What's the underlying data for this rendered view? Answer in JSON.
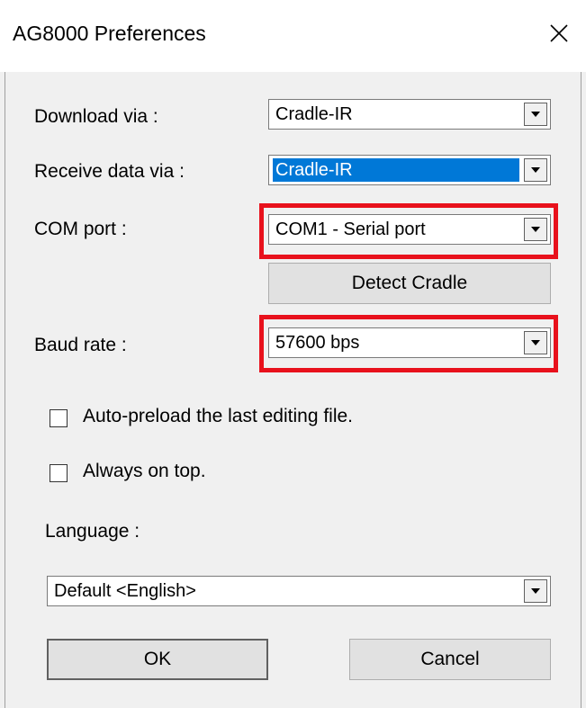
{
  "window": {
    "title": "AG8000 Preferences",
    "close_icon": "close-icon"
  },
  "fields": {
    "download_via": {
      "label": "Download via :",
      "value": "Cradle-IR"
    },
    "receive_data_via": {
      "label": "Receive data via :",
      "value": "Cradle-IR"
    },
    "com_port": {
      "label": "COM port :",
      "value": "COM1 - Serial port"
    },
    "baud_rate": {
      "label": "Baud rate :",
      "value": "57600 bps"
    },
    "language": {
      "label": "Language :",
      "value": "Default <English>"
    }
  },
  "buttons": {
    "detect_cradle": "Detect Cradle",
    "ok": "OK",
    "cancel": "Cancel"
  },
  "checkboxes": {
    "auto_preload": {
      "label": "Auto-preload the last editing file.",
      "checked": false
    },
    "always_on_top": {
      "label": "Always on top.",
      "checked": false
    }
  },
  "colors": {
    "highlight": "#e8111c",
    "selection": "#0078d7"
  }
}
